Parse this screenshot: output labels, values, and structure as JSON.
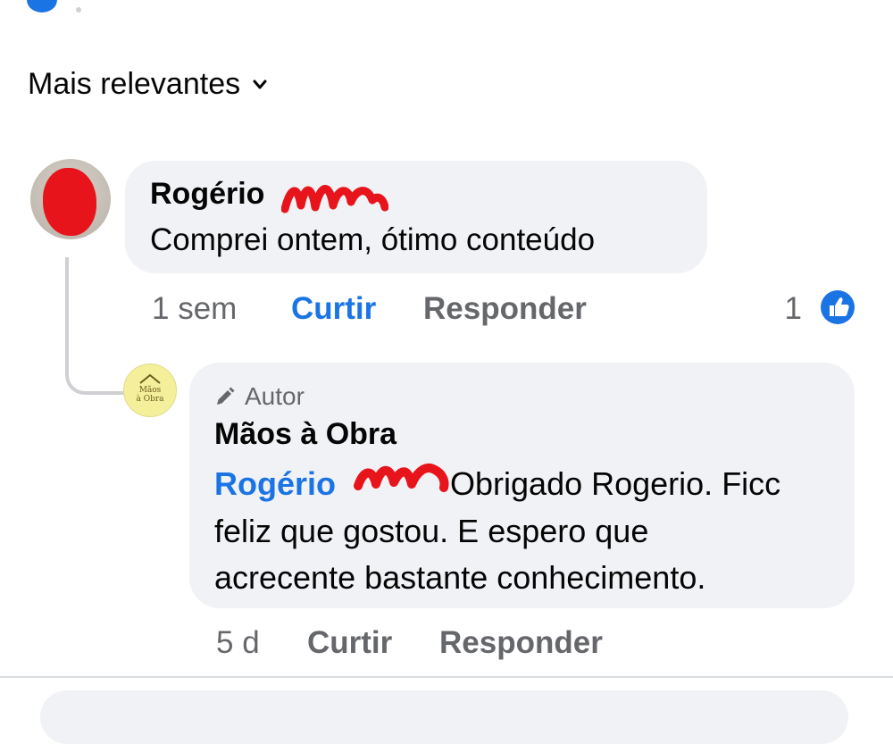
{
  "sort": {
    "label": "Mais relevantes",
    "icon": "chevron-down-icon"
  },
  "comment": {
    "author": "Rogério",
    "text": "Comprei ontem, ótimo conteúdo",
    "time": "1 sem",
    "like_label": "Curtir",
    "reply_label": "Responder",
    "reaction_count": "1",
    "reaction_icon": "like-thumb-icon"
  },
  "reply": {
    "badge_icon": "pencil-icon",
    "badge_label": "Autor",
    "author": "Mãos à Obra",
    "avatar_logo_line1": "Mãos",
    "avatar_logo_line2": "à Obra",
    "mention": "Rogério",
    "text_line1": " Obrigado Rogerio. Ficc",
    "text_line2": "feliz que gostou. E espero que",
    "text_line3": "acrecente bastante conhecimento.",
    "time": "5 d",
    "like_label": "Curtir",
    "reply_label": "Responder"
  },
  "colors": {
    "link_blue": "#1b74e4",
    "bubble_bg": "#f0f2f5",
    "muted_text": "#65676b",
    "redaction_red": "#e8141b"
  }
}
